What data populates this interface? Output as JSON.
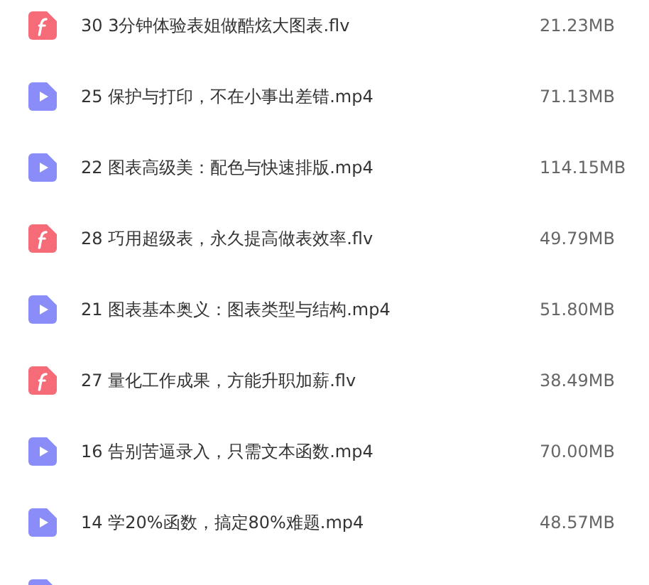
{
  "files": [
    {
      "kind": "flash",
      "name": "30 3分钟体验表姐做酷炫大图表.flv",
      "size": "21.23MB"
    },
    {
      "kind": "video",
      "name": "25 保护与打印，不在小事出差错.mp4",
      "size": "71.13MB"
    },
    {
      "kind": "video",
      "name": "22 图表高级美：配色与快速排版.mp4",
      "size": "114.15MB"
    },
    {
      "kind": "flash",
      "name": "28 巧用超级表，永久提高做表效率.flv",
      "size": "49.79MB"
    },
    {
      "kind": "video",
      "name": "21 图表基本奥义：图表类型与结构.mp4",
      "size": "51.80MB"
    },
    {
      "kind": "flash",
      "name": "27 量化工作成果，方能升职加薪.flv",
      "size": "38.49MB"
    },
    {
      "kind": "video",
      "name": "16 告别苦逼录入，只需文本函数.mp4",
      "size": "70.00MB"
    },
    {
      "kind": "video",
      "name": "14 学20%函数，搞定80%难题.mp4",
      "size": "48.57MB"
    },
    {
      "kind": "video"
    }
  ]
}
